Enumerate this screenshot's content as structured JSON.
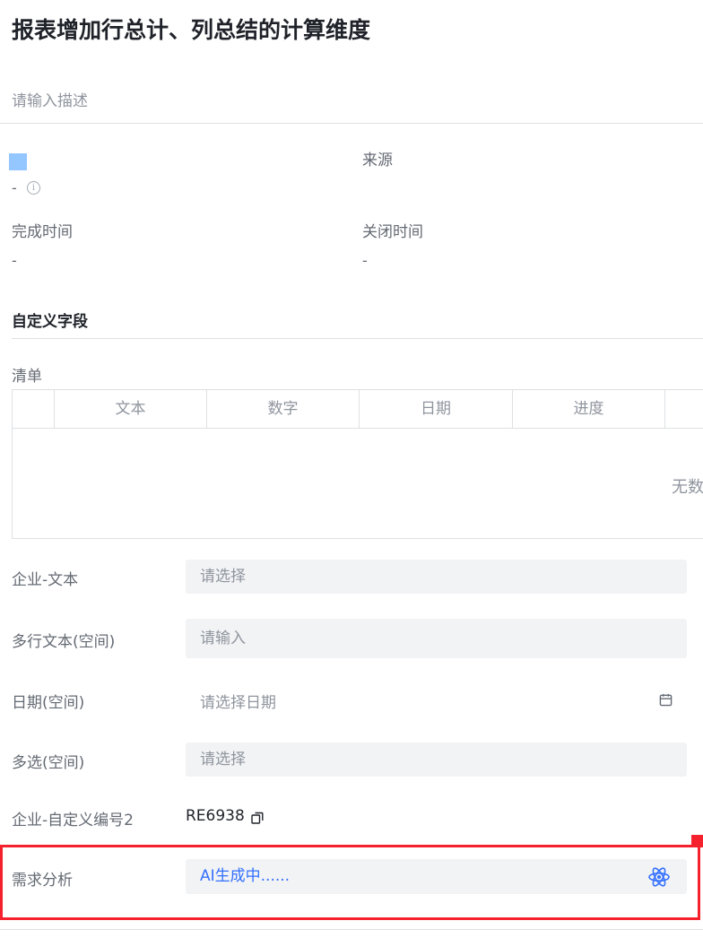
{
  "title": "报表增加行总计、列总结的计算维度",
  "description_placeholder": "请输入描述",
  "info": {
    "field1_value": "-",
    "source_label": "来源",
    "complete_time_label": "完成时间",
    "complete_time_value": "-",
    "close_time_label": "关闭时间",
    "close_time_value": "-"
  },
  "custom_fields": {
    "section_title": "自定义字段",
    "checklist_label": "清单",
    "table_headers": [
      "文本",
      "数字",
      "日期",
      "进度"
    ],
    "empty_text": "无数"
  },
  "fields": [
    {
      "label": "企业-文本",
      "placeholder": "请选择"
    },
    {
      "label": "多行文本(空间)",
      "placeholder": "请输入"
    },
    {
      "label": "日期(空间)",
      "placeholder": "请选择日期"
    },
    {
      "label": "多选(空间)",
      "placeholder": "请选择"
    },
    {
      "label": "企业-自定义编号2",
      "value": "RE6938"
    },
    {
      "label": "需求分析",
      "value": "AI生成中......"
    }
  ],
  "colors": {
    "accent": "#3370ff",
    "highlight_border": "#f5222d",
    "swatch": "#94c6ff"
  }
}
